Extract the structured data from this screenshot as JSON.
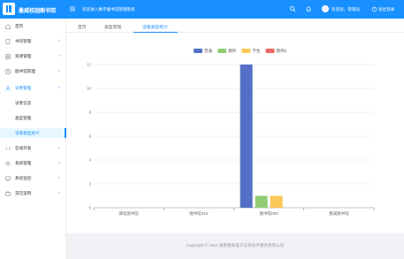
{
  "app": {
    "title": "墨威校园图书馆",
    "welcome": "欢迎进入数字图书馆管理系统"
  },
  "topbar": {
    "user": "欢迎您，管理员",
    "logout": "退出登录"
  },
  "sidebar": {
    "items": [
      {
        "label": "首页",
        "icon": "home-icon"
      },
      {
        "label": "书刊管理",
        "icon": "book-icon"
      },
      {
        "label": "资源管理",
        "icon": "grid-icon"
      },
      {
        "label": "图书馆管理",
        "icon": "library-icon"
      },
      {
        "label": "读者管理",
        "icon": "user-icon"
      },
      {
        "label": "读者信息"
      },
      {
        "label": "类型管理"
      },
      {
        "label": "读者类型统计"
      },
      {
        "label": "在线开发",
        "icon": "code-icon"
      },
      {
        "label": "系统管理",
        "icon": "gear-icon"
      },
      {
        "label": "系统监控",
        "icon": "monitor-icon"
      },
      {
        "label": "常见案例",
        "icon": "case-icon"
      }
    ]
  },
  "tabs": [
    {
      "label": "首页"
    },
    {
      "label": "类型管理"
    },
    {
      "label": "读者类型统计"
    }
  ],
  "footer": "Copyright © 2022 湖南墨威电子信息技术服务有限公司",
  "colors": {
    "primary": "#1890ff",
    "series1": "#5470c6",
    "series2": "#91cc75",
    "series3": "#fac858",
    "series4": "#ee6666"
  },
  "chart_data": {
    "type": "bar",
    "categories": [
      "湖北图书馆",
      "图书馆010",
      "图书馆003",
      "墨威图书馆"
    ],
    "series": [
      {
        "name": "普通",
        "values": [
          0,
          0,
          12,
          0
        ]
      },
      {
        "name": "教师",
        "values": [
          0,
          0,
          1,
          0
        ]
      },
      {
        "name": "学生",
        "values": [
          0,
          0,
          1,
          0
        ]
      },
      {
        "name": "教师2",
        "values": [
          0,
          0,
          0,
          0
        ]
      }
    ],
    "ylim": [
      0,
      12
    ],
    "yticks": [
      0,
      2,
      4,
      6,
      8,
      10,
      12
    ],
    "legend_position": "top-center",
    "grid": true
  }
}
